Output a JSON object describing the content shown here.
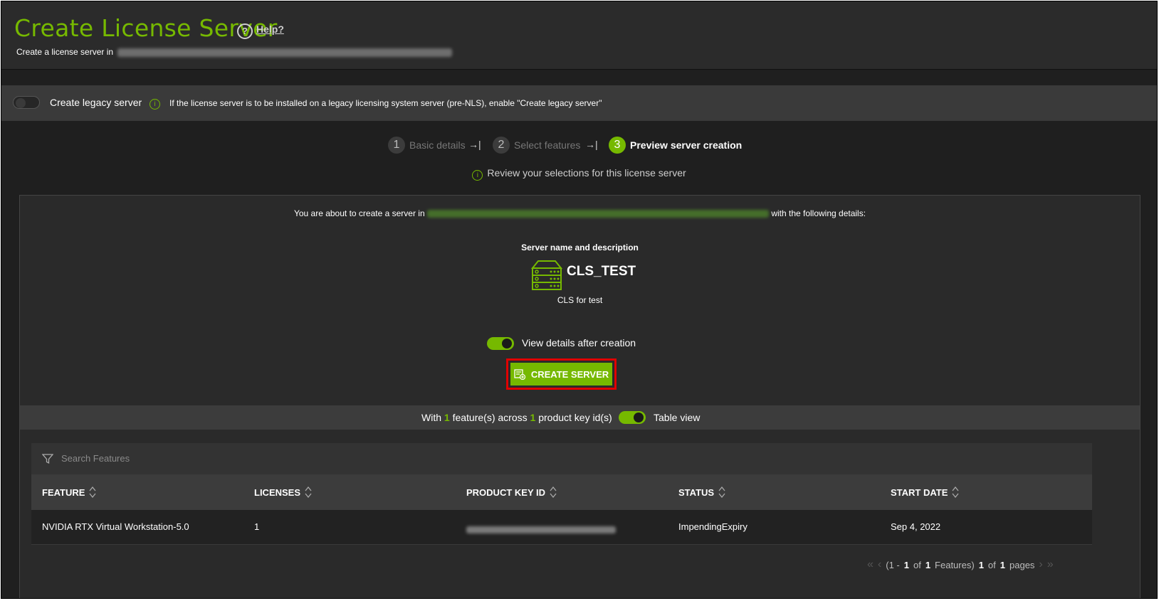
{
  "header": {
    "title": "Create License Server",
    "help_label": "Help?",
    "subtitle_prefix": "Create a license server in"
  },
  "legacy": {
    "label": "Create legacy server",
    "info": "If the license server is to be installed on a legacy licensing system server (pre-NLS), enable \"Create legacy server\""
  },
  "steps": [
    {
      "num": "1",
      "label": "Basic details",
      "state": "done"
    },
    {
      "num": "2",
      "label": "Select features",
      "state": "done"
    },
    {
      "num": "3",
      "label": "Preview server creation",
      "state": "active"
    }
  ],
  "review_note": "Review your selections for this license server",
  "preview": {
    "about_prefix": "You are about to create a server in",
    "about_suffix": "with the following details:",
    "section_title": "Server name and description",
    "server_name": "CLS_TEST",
    "server_description": "CLS for test",
    "view_details_label": "View details after creation",
    "view_details_enabled": true,
    "create_button_label": "CREATE SERVER"
  },
  "summary": {
    "prefix": "With",
    "feature_count": "1",
    "middle": "feature(s) across",
    "key_count": "1",
    "suffix": "product key id(s)",
    "table_view_label": "Table view",
    "table_view_enabled": true
  },
  "search": {
    "placeholder": "Search Features"
  },
  "table": {
    "columns": [
      "FEATURE",
      "LICENSES",
      "PRODUCT KEY ID",
      "STATUS",
      "START DATE"
    ],
    "rows": [
      {
        "feature": "NVIDIA RTX Virtual Workstation-5.0",
        "licenses": "1",
        "product_key_id": "",
        "status": "ImpendingExpiry",
        "start_date": "Sep 4, 2022"
      }
    ]
  },
  "pagination": {
    "open": "(1 -",
    "range_end": "1",
    "of1": "of",
    "total": "1",
    "features_label": "Features)",
    "page": "1",
    "of2": "of",
    "pages": "1",
    "pages_label": "pages"
  },
  "colors": {
    "accent": "#76b900",
    "highlight": "#e00000"
  }
}
